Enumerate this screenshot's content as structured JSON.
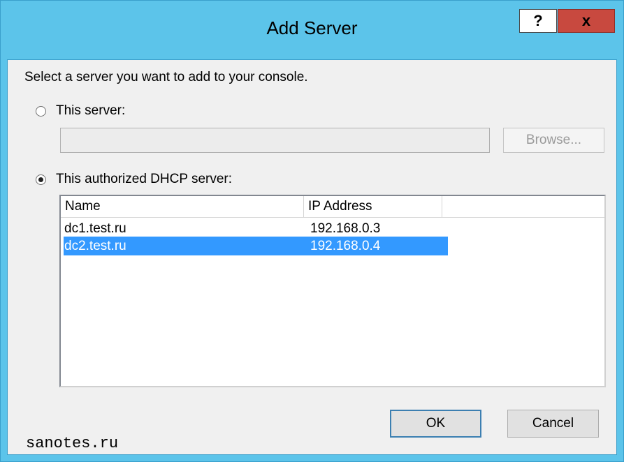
{
  "window": {
    "title": "Add Server",
    "help_label": "?",
    "close_label": "x"
  },
  "dialog": {
    "instruction": "Select a server you want to add to your console.",
    "option_this_server": {
      "label": "This server:",
      "selected": false
    },
    "server_input": {
      "value": "",
      "enabled": false
    },
    "browse_label": "Browse...",
    "option_authorized": {
      "label": "This authorized DHCP server:",
      "selected": true
    },
    "list": {
      "columns": [
        "Name",
        "IP Address",
        ""
      ],
      "rows": [
        {
          "name": "dc1.test.ru",
          "ip": "192.168.0.3",
          "selected": false
        },
        {
          "name": "dc2.test.ru",
          "ip": "192.168.0.4",
          "selected": true
        }
      ]
    },
    "ok_label": "OK",
    "cancel_label": "Cancel"
  },
  "watermark": "sanotes.ru",
  "colors": {
    "titlebar": "#5cc4ea",
    "close_button": "#c8493f",
    "selection": "#3399ff",
    "dialog_bg": "#f0f0f0"
  }
}
